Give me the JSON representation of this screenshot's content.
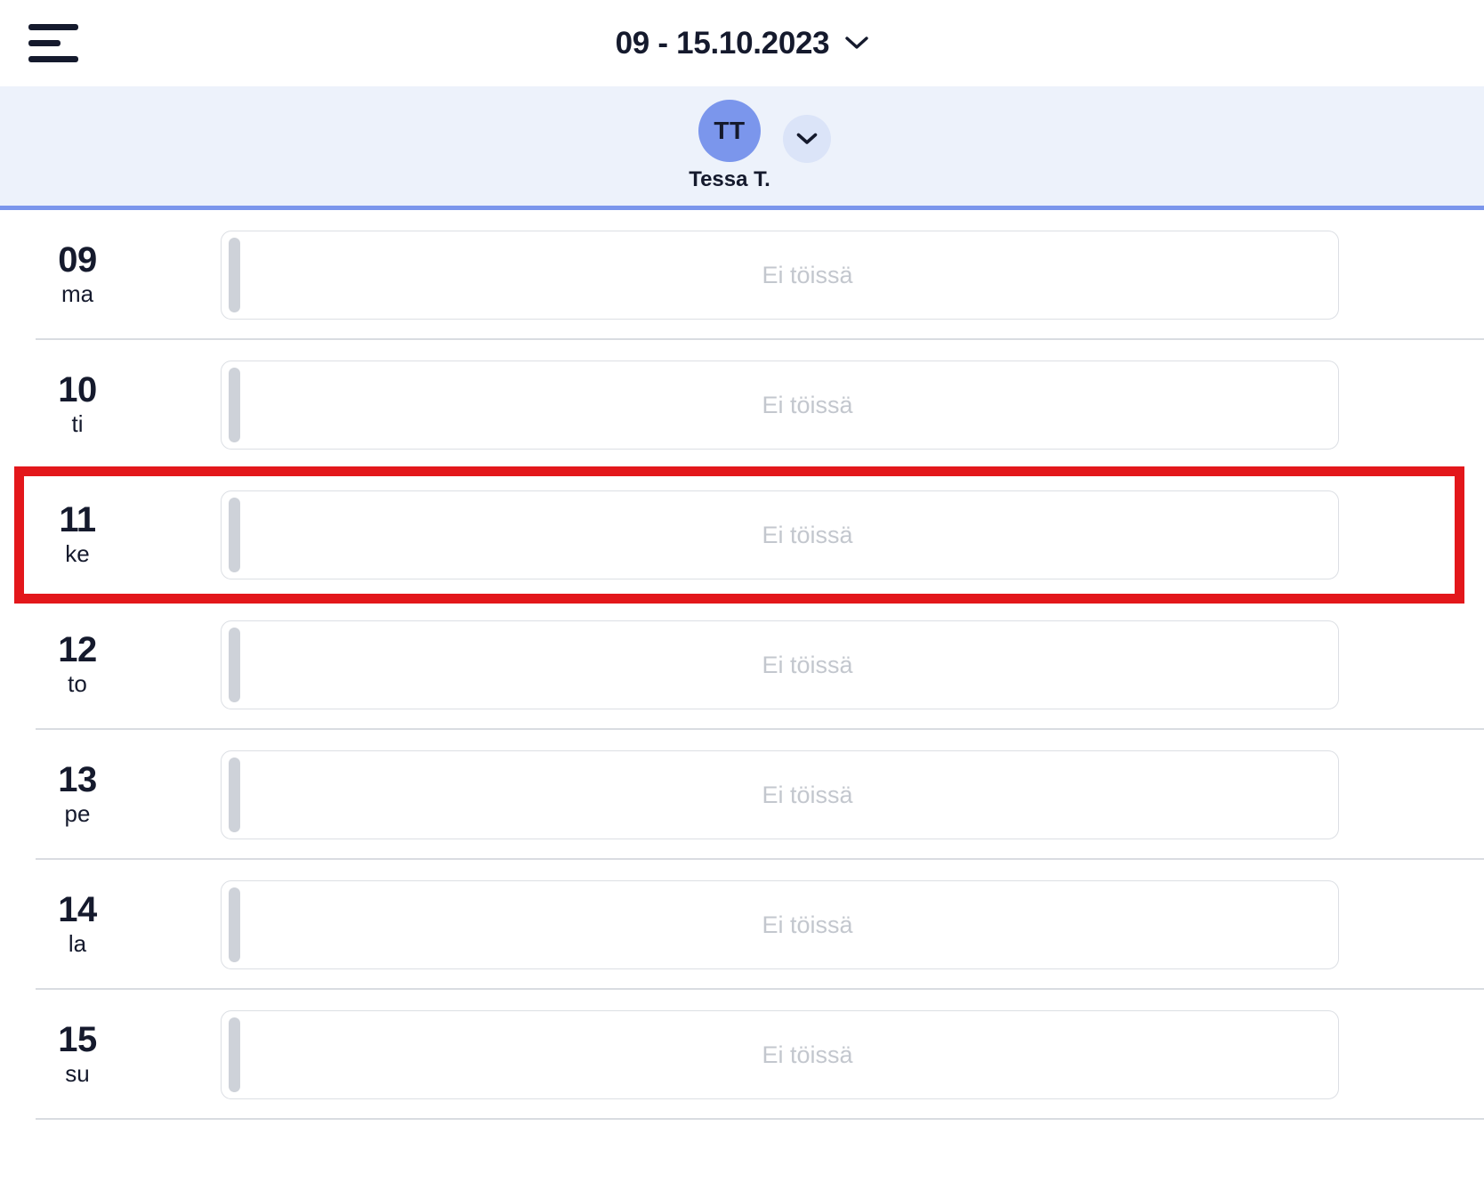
{
  "header": {
    "menu_icon": "hamburger-menu-icon",
    "title": "09 - 15.10.2023",
    "title_chevron_icon": "chevron-down-icon"
  },
  "user_band": {
    "avatar_initials": "TT",
    "user_name": "Tessa T.",
    "dropdown_icon": "chevron-down-icon"
  },
  "colors": {
    "accent_blue": "#7b96ec",
    "band_background": "#edf2fb",
    "highlight_red": "#e3171b",
    "text_dark": "#151a2d",
    "muted_text": "#c3c7ce"
  },
  "days": [
    {
      "num": "09",
      "abbr": "ma",
      "status": "Ei töissä",
      "highlighted": false
    },
    {
      "num": "10",
      "abbr": "ti",
      "status": "Ei töissä",
      "highlighted": false
    },
    {
      "num": "11",
      "abbr": "ke",
      "status": "Ei töissä",
      "highlighted": true
    },
    {
      "num": "12",
      "abbr": "to",
      "status": "Ei töissä",
      "highlighted": false
    },
    {
      "num": "13",
      "abbr": "pe",
      "status": "Ei töissä",
      "highlighted": false
    },
    {
      "num": "14",
      "abbr": "la",
      "status": "Ei töissä",
      "highlighted": false
    },
    {
      "num": "15",
      "abbr": "su",
      "status": "Ei töissä",
      "highlighted": false
    }
  ]
}
